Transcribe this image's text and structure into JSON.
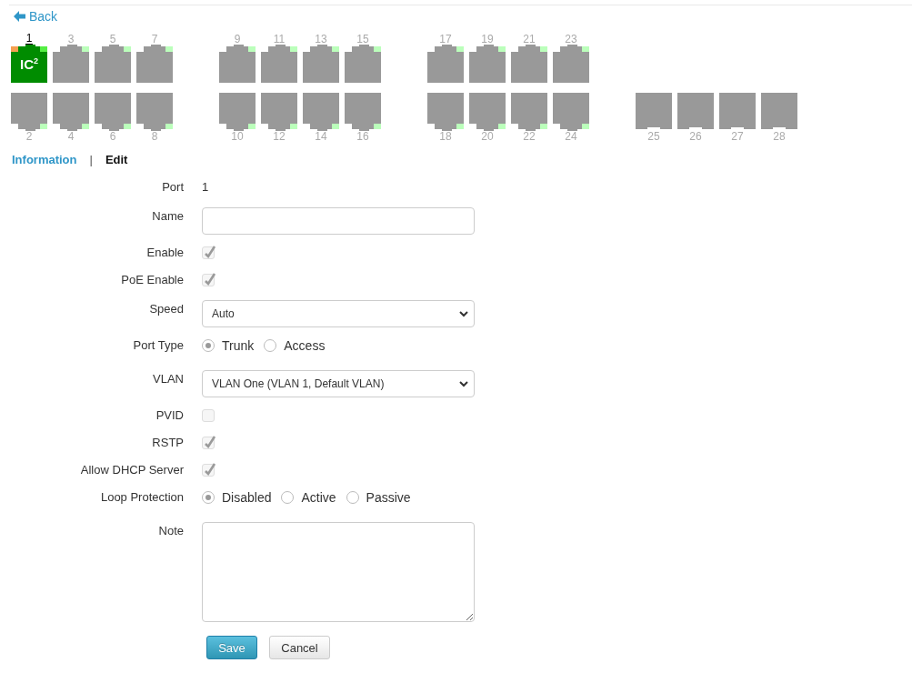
{
  "back_link": {
    "label": "Back"
  },
  "port_groups": [
    {
      "kind": "rj45",
      "ports": [
        {
          "label": "1",
          "selected": true,
          "connected": true,
          "badge": "IC$^{2}$"
        },
        {
          "label": "2",
          "selected": false,
          "connected": false
        },
        {
          "label": "3",
          "selected": false,
          "connected": false
        },
        {
          "label": "4",
          "selected": false,
          "connected": false
        },
        {
          "label": "5",
          "selected": false,
          "connected": false
        },
        {
          "label": "6",
          "selected": false,
          "connected": false
        },
        {
          "label": "7",
          "selected": false,
          "connected": false
        },
        {
          "label": "8",
          "selected": false,
          "connected": false
        }
      ]
    },
    {
      "kind": "rj45",
      "ports": [
        {
          "label": "9",
          "selected": false,
          "connected": false
        },
        {
          "label": "10",
          "selected": false,
          "connected": false
        },
        {
          "label": "11",
          "selected": false,
          "connected": false
        },
        {
          "label": "12",
          "selected": false,
          "connected": false
        },
        {
          "label": "13",
          "selected": false,
          "connected": false
        },
        {
          "label": "14",
          "selected": false,
          "connected": false
        },
        {
          "label": "15",
          "selected": false,
          "connected": false
        },
        {
          "label": "16",
          "selected": false,
          "connected": false
        }
      ]
    },
    {
      "kind": "rj45",
      "ports": [
        {
          "label": "17",
          "selected": false,
          "connected": false
        },
        {
          "label": "18",
          "selected": false,
          "connected": false
        },
        {
          "label": "19",
          "selected": false,
          "connected": false
        },
        {
          "label": "20",
          "selected": false,
          "connected": false
        },
        {
          "label": "21",
          "selected": false,
          "connected": false
        },
        {
          "label": "22",
          "selected": false,
          "connected": false
        },
        {
          "label": "23",
          "selected": false,
          "connected": false
        },
        {
          "label": "24",
          "selected": false,
          "connected": false
        }
      ]
    },
    {
      "kind": "sfp",
      "ports": [
        {
          "label": "25",
          "selected": false,
          "connected": false
        },
        {
          "label": "26",
          "selected": false,
          "connected": false
        },
        {
          "label": "27",
          "selected": false,
          "connected": false
        },
        {
          "label": "28",
          "selected": false,
          "connected": false
        }
      ]
    }
  ],
  "tabs": [
    {
      "label": "Information",
      "selected": false
    },
    {
      "label": "Edit",
      "selected": true
    }
  ],
  "tab_separator": "|",
  "form": {
    "fields": [
      {
        "kind": "text",
        "label": "Port",
        "value": "1"
      },
      {
        "kind": "input",
        "label": "Name"
      },
      {
        "kind": "checkbox",
        "label": "Enable",
        "checked": true,
        "disabled": true
      },
      {
        "kind": "checkbox",
        "label": "PoE Enable",
        "checked": true,
        "disabled": true
      },
      {
        "kind": "select",
        "label": "Speed",
        "value": "Auto"
      },
      {
        "kind": "radio",
        "label": "Port Type",
        "options": [
          {
            "label": "Trunk",
            "selected": true
          },
          {
            "label": "Access",
            "selected": false
          }
        ]
      },
      {
        "kind": "select",
        "label": "VLAN",
        "value": "VLAN One (VLAN 1, Default VLAN)"
      },
      {
        "kind": "checkbox",
        "label": "PVID",
        "checked": false,
        "disabled": true
      },
      {
        "kind": "checkbox",
        "label": "RSTP",
        "checked": true,
        "disabled": true
      },
      {
        "kind": "checkbox",
        "label": "Allow DHCP Server",
        "checked": true,
        "disabled": true
      },
      {
        "kind": "radio",
        "label": "Loop Protection",
        "options": [
          {
            "label": "Disabled",
            "selected": true
          },
          {
            "label": "Active",
            "selected": false
          },
          {
            "label": "Passive",
            "selected": false
          }
        ]
      },
      {
        "kind": "textarea",
        "label": "Note"
      }
    ],
    "buttons": [
      {
        "label": "Save",
        "kind": "primary"
      },
      {
        "label": "Cancel",
        "kind": "default"
      }
    ]
  }
}
